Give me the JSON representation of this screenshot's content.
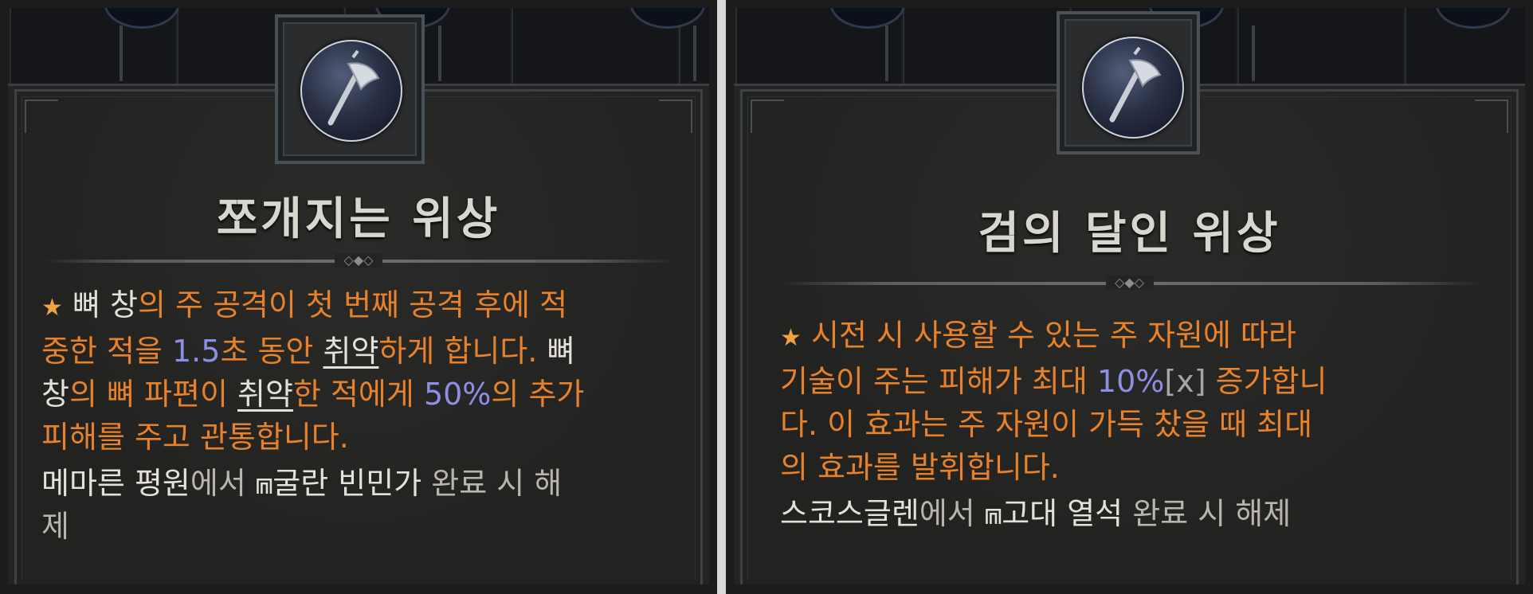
{
  "cards": [
    {
      "icon": "axe-icon",
      "title": "쪼개지는 위상",
      "desc": {
        "star": "★",
        "l1_a": "뼈 창",
        "l1_b": "의 주 공격이 첫 번째 공격 후에 적",
        "l2_a": "중한 적을 ",
        "l2_num": "1.5",
        "l2_b": "초 동안 ",
        "l2_ul": "취약",
        "l2_c": "하게 합니다. ",
        "l2_w": "뼈",
        "l3_w": "창",
        "l3_a": "의 뼈 파편이 ",
        "l3_ul": "취약",
        "l3_b": "한 적에게 ",
        "l3_num": "50%",
        "l3_c": "의 추가",
        "l4": "피해를 주고 관통합니다."
      },
      "unlock": {
        "loc": "메마른 평원",
        "a": "에서 ",
        "gate_icon": "gate-icon",
        "gate": "굴란 빈민가",
        "b": " 완료 시 해",
        "c": "제"
      }
    },
    {
      "icon": "axe-icon",
      "title": "검의 달인 위상",
      "desc": {
        "star": "★",
        "l1": "시전 시 사용할 수 있는 주 자원에 따라",
        "l2_a": "기술이 주는 피해가 최대 ",
        "l2_num": "10%",
        "l2_br": "[x]",
        "l2_b": " 증가합니",
        "l3": "다. 이 효과는 주 자원이 가득 찼을 때 최대",
        "l4": "의 효과를 발휘합니다."
      },
      "unlock": {
        "loc": "스코스글렌",
        "a": "에서 ",
        "gate_icon": "gate-icon",
        "gate": "고대 열석",
        "b": " 완료 시 해제"
      }
    }
  ]
}
